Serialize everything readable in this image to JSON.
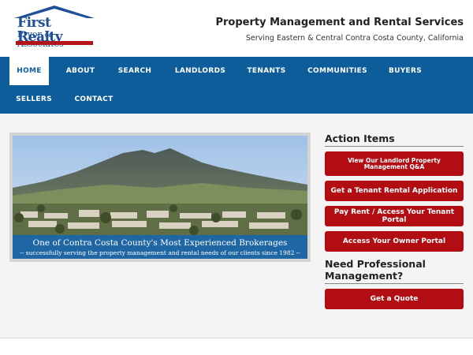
{
  "logo": {
    "line1": "First Realty",
    "line2": "Pryor & Associates"
  },
  "header": {
    "title": "Property Management and Rental Services",
    "subtitle": "Serving Eastern & Central Contra Costa County, California"
  },
  "nav": {
    "items": [
      {
        "label": "HOME",
        "active": true
      },
      {
        "label": "ABOUT"
      },
      {
        "label": "SEARCH"
      },
      {
        "label": "LANDLORDS"
      },
      {
        "label": "TENANTS"
      },
      {
        "label": "COMMUNITIES"
      },
      {
        "label": "BUYERS"
      },
      {
        "label": "SELLERS"
      },
      {
        "label": "CONTACT"
      }
    ]
  },
  "hero": {
    "caption": "One of Contra Costa County's Most Experienced Brokerages",
    "subcaption": "-- successfully serving the property management and rental needs of our clients since 1982 --"
  },
  "sidebar": {
    "action_heading": "Action Items",
    "buttons": [
      "View Our Landlord Property Management Q&A",
      "Get a Tenant Rental Application",
      "Pay Rent / Access Your Tenant Portal",
      "Access Your Owner Portal"
    ],
    "pro_heading": "Need Professional Management?",
    "quote_button": "Get a Quote"
  },
  "colors": {
    "brand_blue": "#0d5d9b",
    "button_red": "#b20d12",
    "logo_blue": "#1e4f98"
  }
}
